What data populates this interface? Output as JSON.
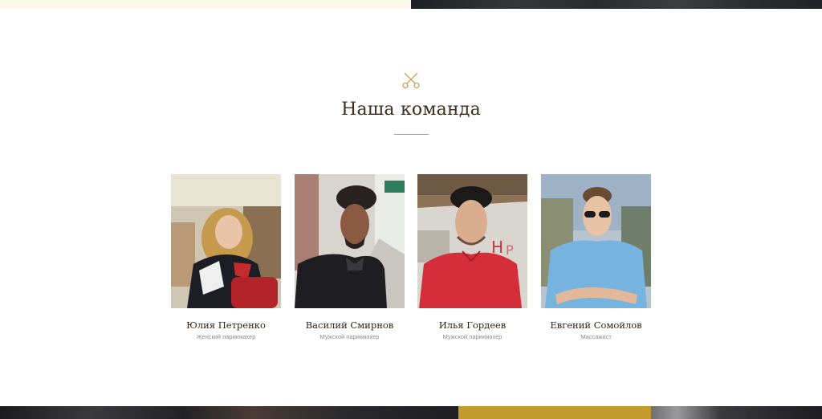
{
  "section": {
    "title": "Наша команда"
  },
  "team": [
    {
      "name": "Юлия Петренко",
      "role": "Женский парикмахер"
    },
    {
      "name": "Василий Смирнов",
      "role": "Мужской парикмахер"
    },
    {
      "name": "Илья Гордеев",
      "role": "Мужской парикмахер"
    },
    {
      "name": "Евгений Сомойлов",
      "role": "Массажист"
    }
  ],
  "colors": {
    "accent": "#c6a552",
    "heading": "#3a2f22",
    "subtext": "#8c8c8c",
    "cta_strip": "#c29b2c"
  },
  "icons": {
    "section_icon": "scissors-icon"
  }
}
